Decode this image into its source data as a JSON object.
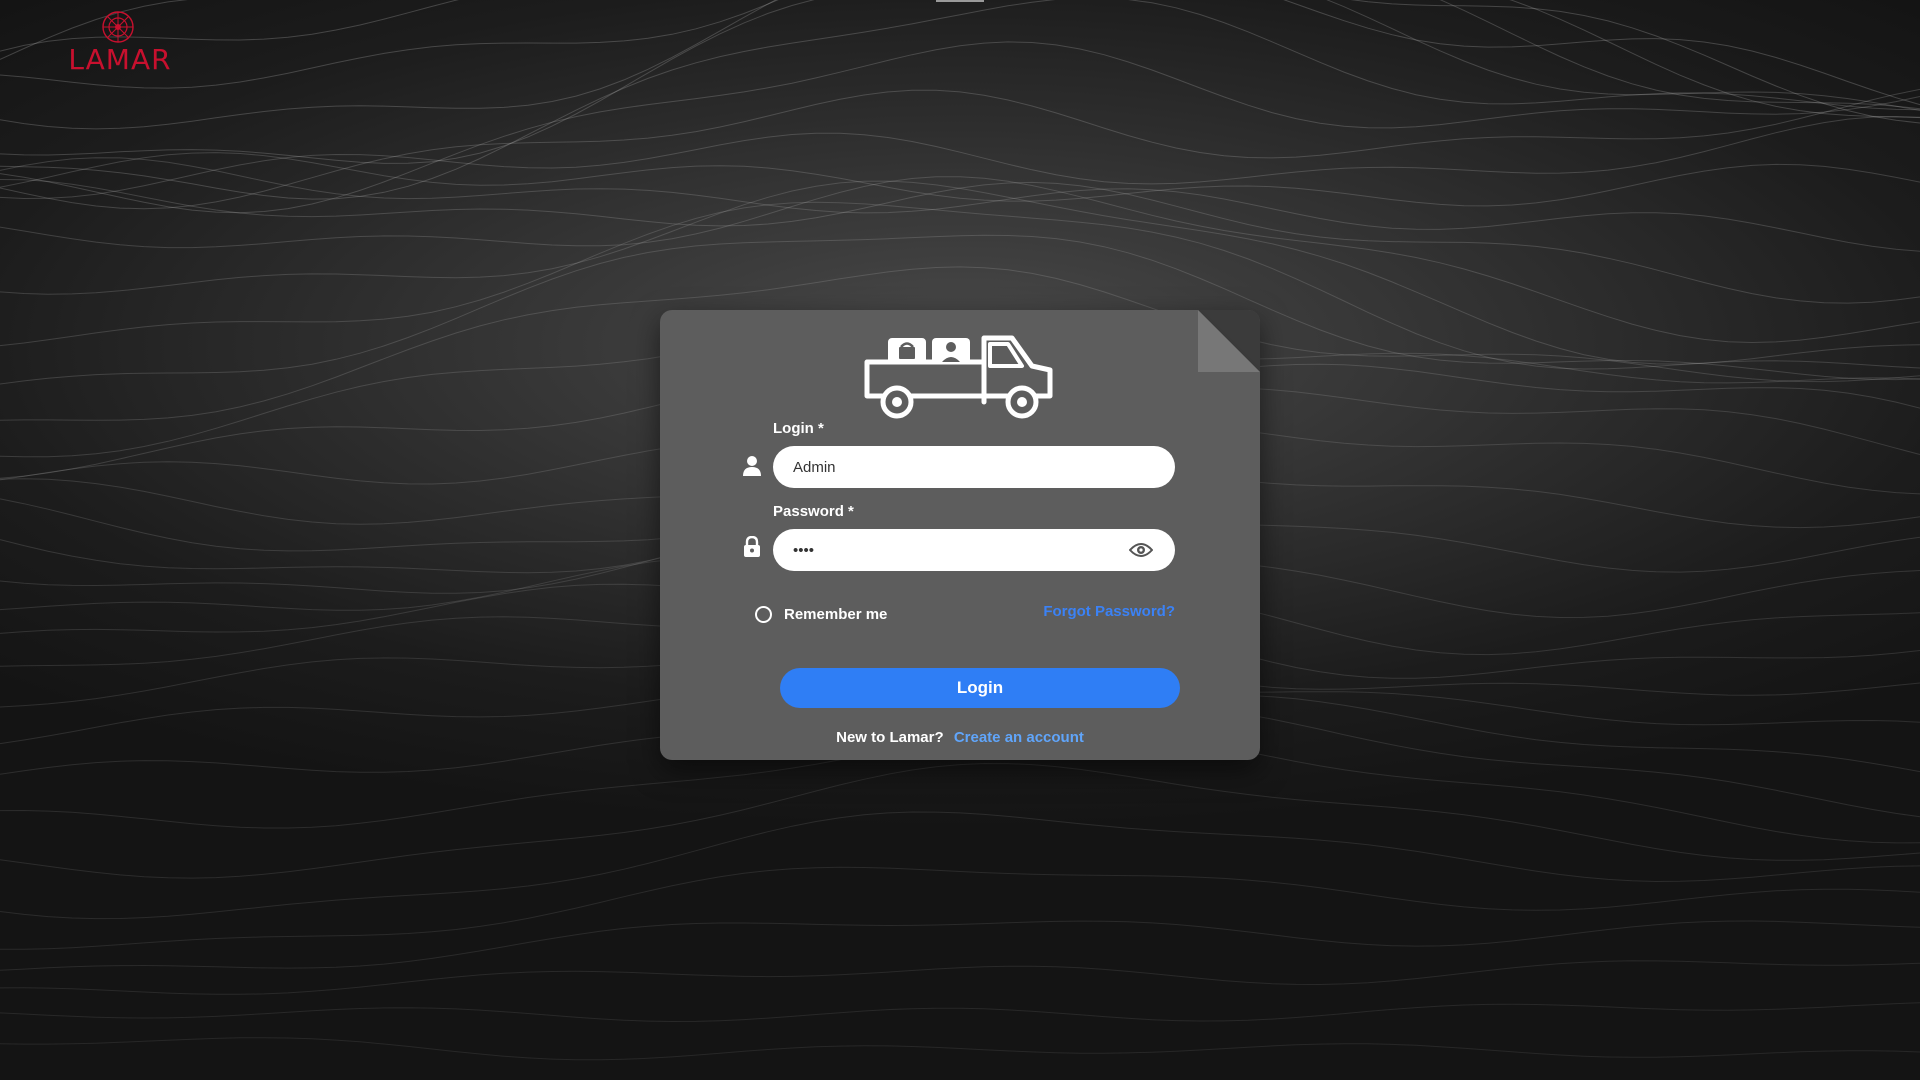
{
  "brand": {
    "name": "LAMAR",
    "color": "#c8102e"
  },
  "login_form": {
    "login_label": "Login *",
    "login_value": "Admin",
    "password_label": "Password *",
    "password_value": "1234",
    "remember_label": "Remember me",
    "forgot_link": "Forgot Password?",
    "submit_label": "Login",
    "signup_prompt": "New to Lamar?",
    "signup_link": "Create an account"
  },
  "icons": {
    "login_field": "user-icon",
    "password_field": "lock-icon",
    "password_toggle": "eye-icon",
    "header_illustration": "truck-icon",
    "logo_mark": "emblem-icon"
  },
  "colors": {
    "card_background": "#5d5d5d",
    "primary_button": "#2f7ef5",
    "link": "#3b82f6"
  }
}
